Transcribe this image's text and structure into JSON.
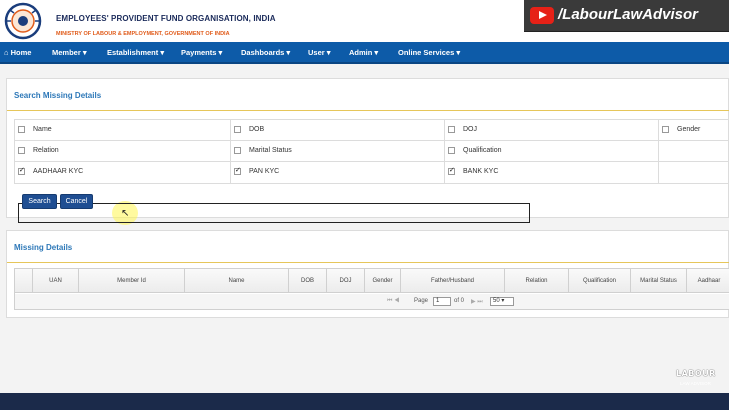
{
  "header": {
    "org_title": "EMPLOYEES' PROVIDENT FUND ORGANISATION, INDIA",
    "org_subtitle": "MINISTRY OF LABOUR & EMPLOYMENT, GOVERNMENT OF INDIA",
    "channel_banner": "/LabourLawAdvisor"
  },
  "nav": {
    "home": "Home",
    "member": "Member ▾",
    "establishment": "Establishment ▾",
    "payments": "Payments ▾",
    "dashboards": "Dashboards ▾",
    "user": "User ▾",
    "admin": "Admin ▾",
    "online_services": "Online Services ▾"
  },
  "search_panel": {
    "title": "Search Missing Details",
    "fields": [
      {
        "label": "Name",
        "checked": false
      },
      {
        "label": "DOB",
        "checked": false
      },
      {
        "label": "DOJ",
        "checked": false
      },
      {
        "label": "Gender",
        "checked": false
      },
      {
        "label": "Relation",
        "checked": false
      },
      {
        "label": "Marital Status",
        "checked": false
      },
      {
        "label": "Qualification",
        "checked": false
      },
      {
        "label": "AADHAAR KYC",
        "checked": true
      },
      {
        "label": "PAN KYC",
        "checked": true
      },
      {
        "label": "BANK KYC",
        "checked": true
      }
    ],
    "search_label": "Search",
    "cancel_label": "Cancel"
  },
  "results_panel": {
    "title": "Missing Details",
    "columns": [
      "",
      "UAN",
      "Member Id",
      "Name",
      "DOB",
      "DOJ",
      "Gender",
      "Father/Husband",
      "Relation",
      "Qualification",
      "Marital Status",
      "Aadhaar"
    ],
    "pager": {
      "nav_left": "⏮ ◀",
      "page_label": "Page",
      "page_value": "1",
      "of_label": "of 0",
      "nav_right": "▶ ⏭",
      "page_size": "50"
    }
  },
  "watermark": {
    "title": "LABOUR",
    "subtitle": "LAW ADVISOR"
  },
  "colors": {
    "nav_bg": "#0d5ba8",
    "panel_title": "#2d78b8",
    "button_bg": "#1f4e92",
    "rule": "#e6c65a",
    "footer_bg": "#1b2a4a"
  }
}
